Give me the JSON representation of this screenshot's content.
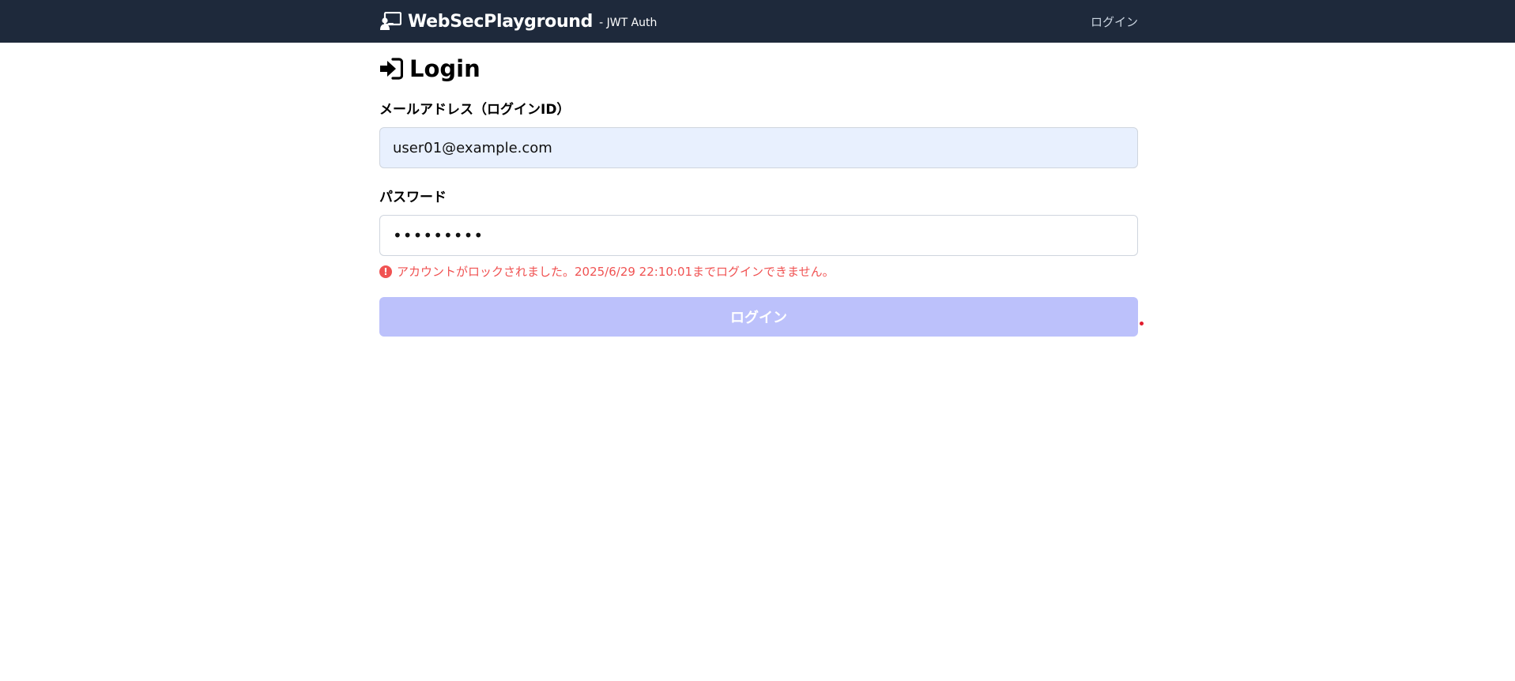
{
  "navbar": {
    "brand_title": "WebSecPlayground",
    "brand_subtitle": "- JWT Auth",
    "brand_icon": "presentation-user-icon",
    "login_link": "ログイン"
  },
  "page": {
    "title": "Login",
    "title_icon": "sign-in-icon"
  },
  "form": {
    "email_label": "メールアドレス（ログインID）",
    "email_value": "user01@example.com",
    "password_label": "パスワード",
    "password_value": "•••••••••",
    "error_icon": "exclamation-circle-icon",
    "error_message": "アカウントがロックされました。2025/6/29 22:10:01までログインできません。",
    "submit_label": "ログイン"
  },
  "colors": {
    "navbar_bg": "#1e293b",
    "error": "#f05252",
    "button_disabled": "#bcc1fb",
    "autofill_bg": "#e8f0fe"
  }
}
